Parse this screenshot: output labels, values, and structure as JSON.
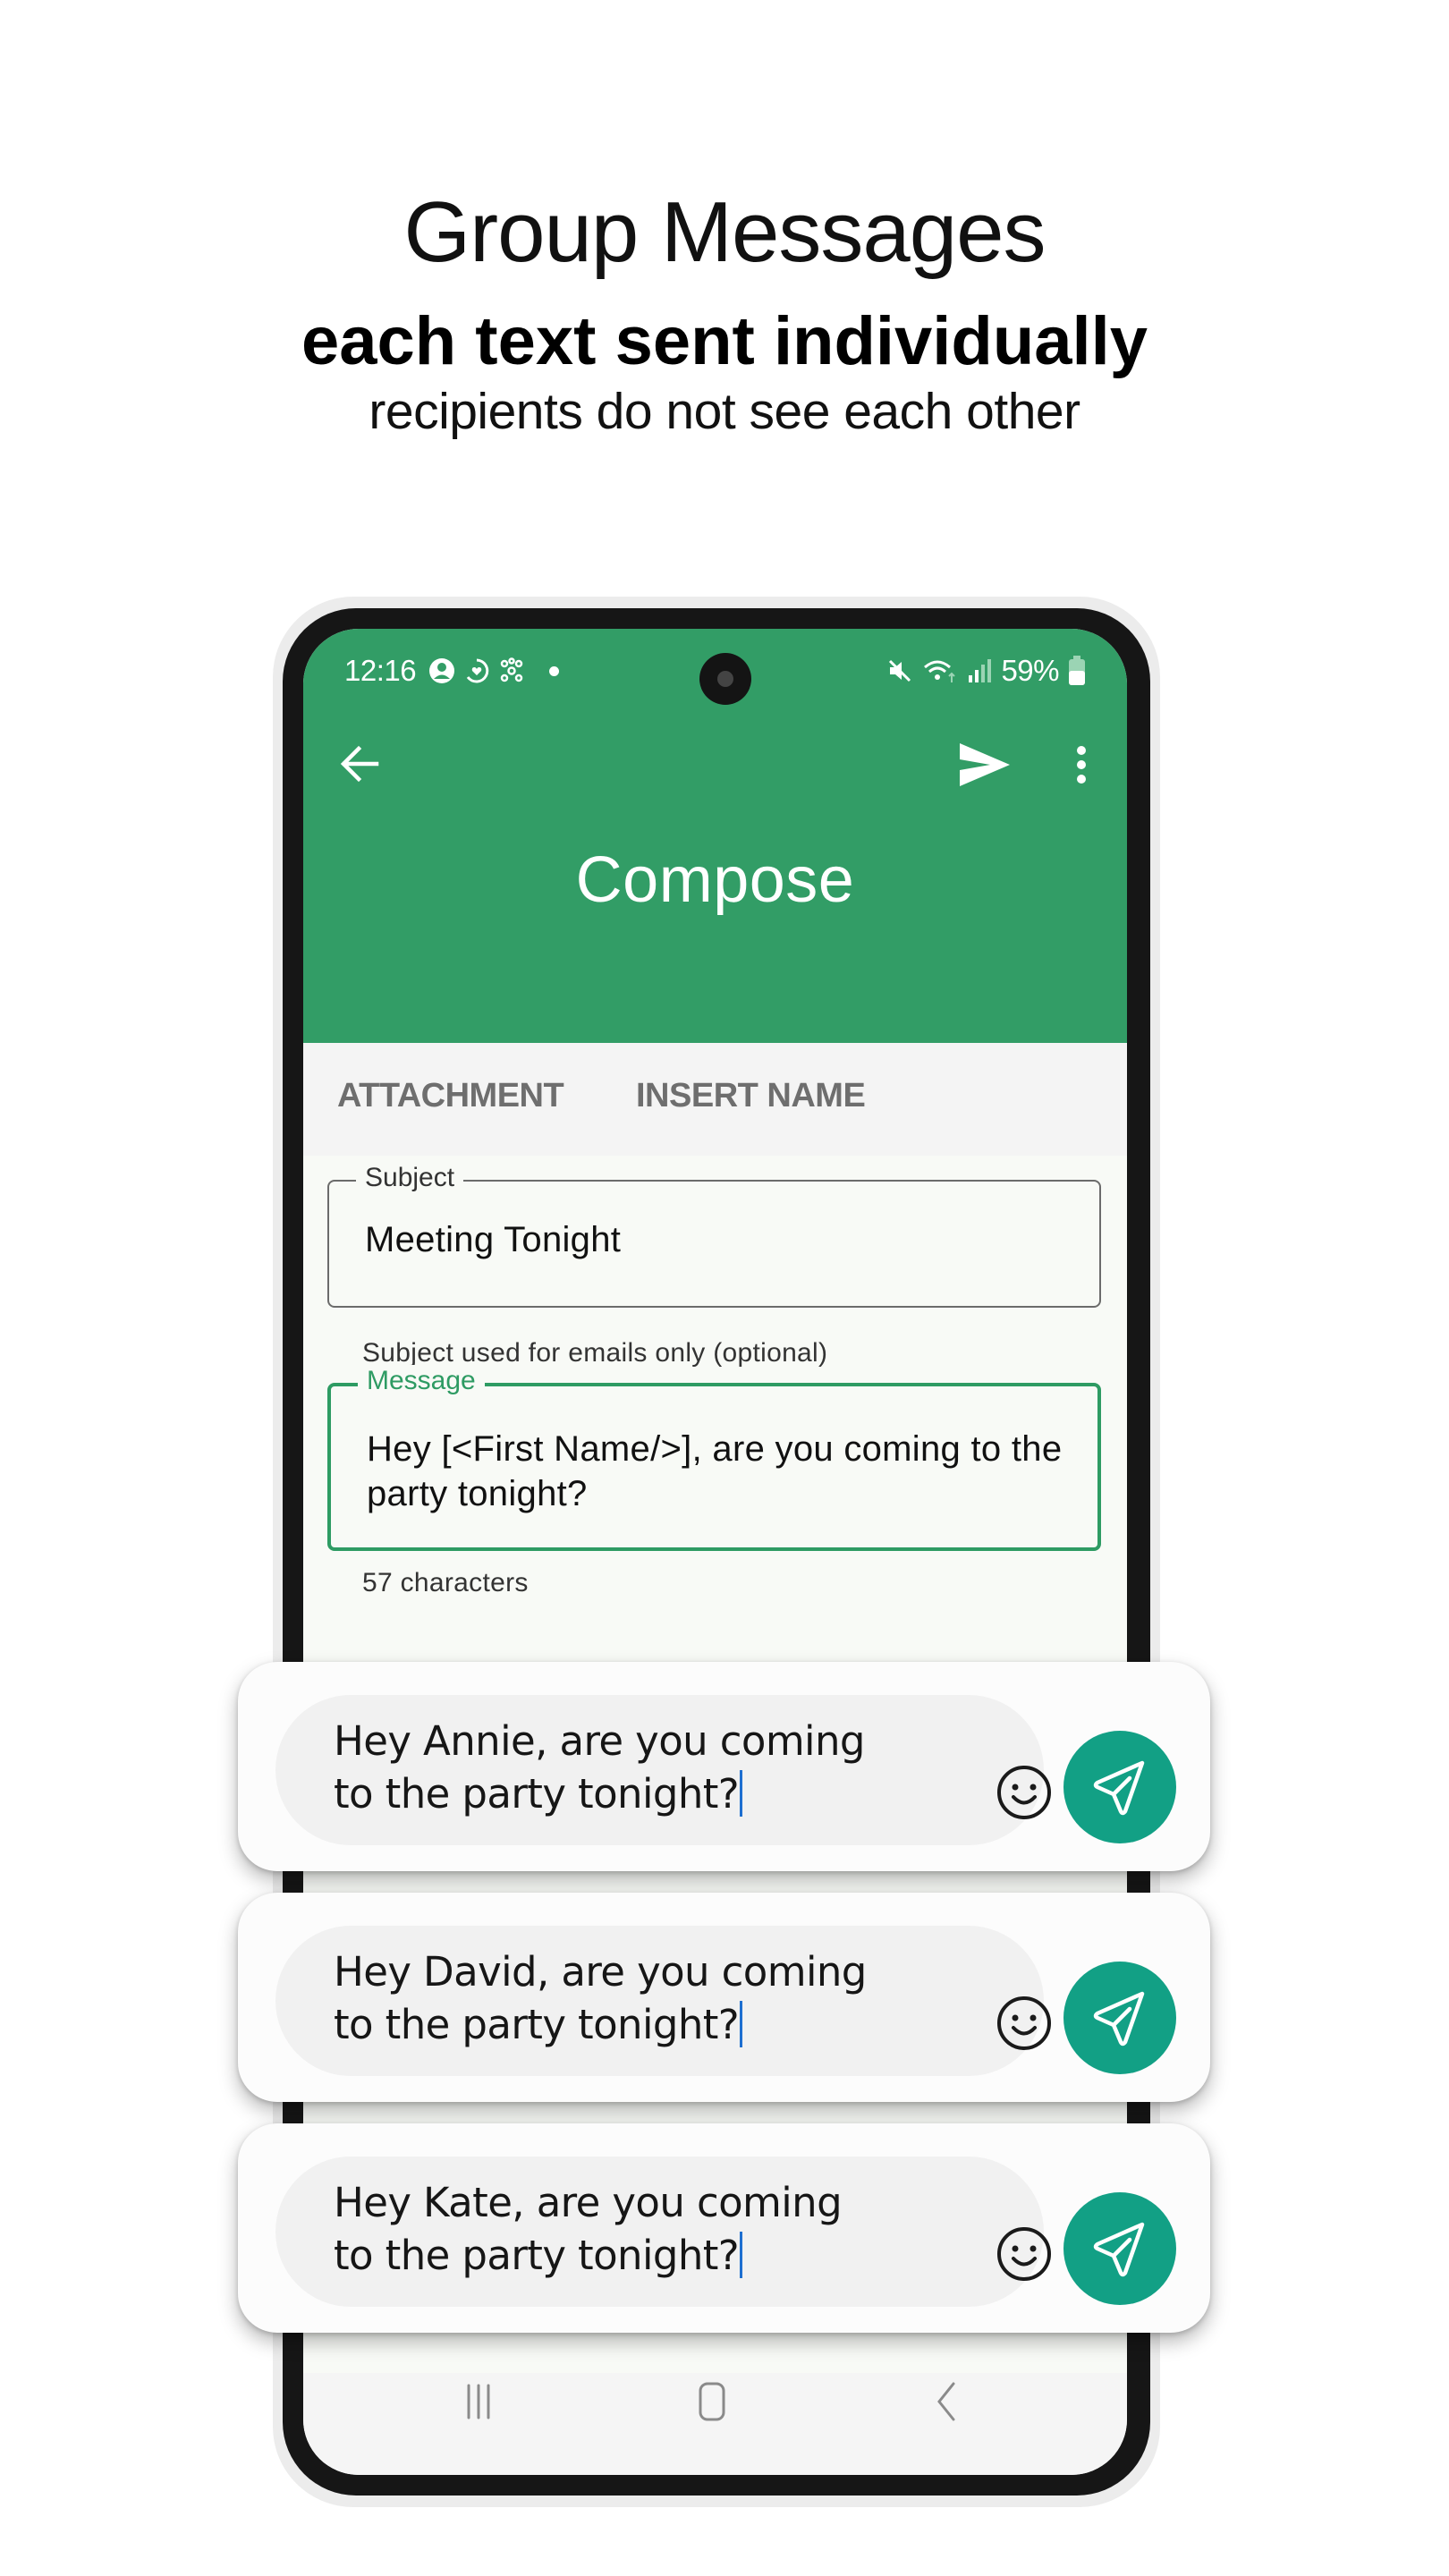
{
  "hero": {
    "title": "Group Messages",
    "subtitle": "each text sent individually",
    "note": "recipients do not see each other"
  },
  "status_bar": {
    "time": "12:16",
    "left_icons": [
      "account-circle-icon",
      "heart-ring-icon",
      "network-nodes-icon",
      "notification-dot-icon"
    ],
    "right_icons": [
      "mute-icon",
      "wifi-icon",
      "signal-icon",
      "battery-icon"
    ],
    "battery": "59%"
  },
  "app_bar": {
    "title": "Compose",
    "back_icon": "arrow-left-icon",
    "send_icon": "send-icon",
    "more_icon": "more-vertical-icon"
  },
  "toolbar": {
    "attachment_label": "ATTACHMENT",
    "insert_name_label": "INSERT NAME"
  },
  "form": {
    "subject_label": "Subject",
    "subject_value": "Meeting Tonight",
    "subject_helper": "Subject used for emails only (optional)",
    "message_label": "Message",
    "message_value": "Hey [<First Name/>], are you coming to the party tonight?",
    "char_count": "57 characters"
  },
  "colors": {
    "app_bar": "#329d66",
    "accent": "#2e9b63",
    "send_fab": "#12a085",
    "cursor": "#1e6fd0"
  },
  "preview_cards": [
    {
      "line1": "Hey Annie, are you coming",
      "line2": "to the party tonight?"
    },
    {
      "line1": "Hey David, are you coming",
      "line2": "to the party tonight?"
    },
    {
      "line1": "Hey Kate, are you coming",
      "line2": "to the party tonight?"
    }
  ],
  "nav_bar": {
    "icons": [
      "recent-apps-icon",
      "home-icon",
      "back-icon"
    ]
  }
}
